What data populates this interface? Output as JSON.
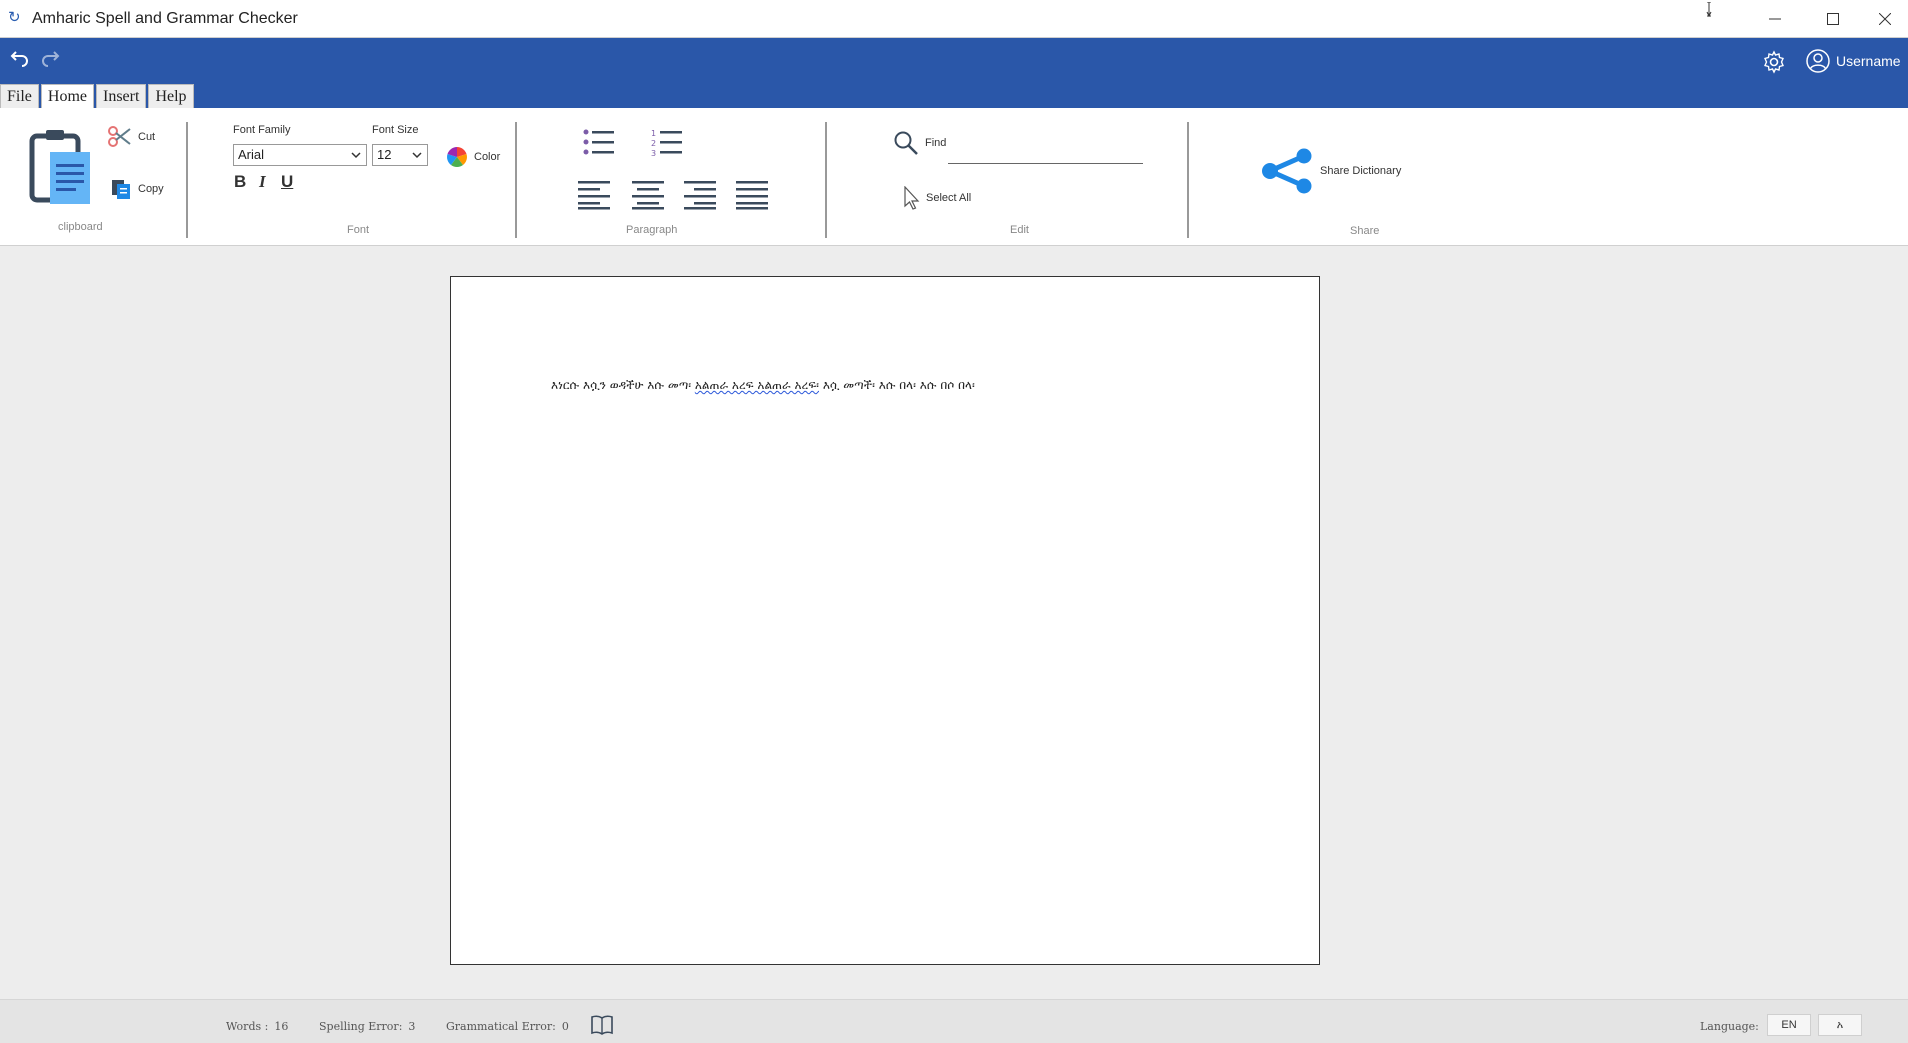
{
  "window": {
    "title": "Amharic Spell and Grammar Checker",
    "app_icon": "amharic-logo-icon"
  },
  "quickbar": {
    "username": "Username"
  },
  "tabs": [
    {
      "label": "File"
    },
    {
      "label": "Home"
    },
    {
      "label": "Insert"
    },
    {
      "label": "Help"
    }
  ],
  "ribbon": {
    "clipboard": {
      "group_label": "clipboard",
      "cut": "Cut",
      "copy": "Copy"
    },
    "font": {
      "group_label": "Font",
      "family_label": "Font Family",
      "family_value": "Arial",
      "size_label": "Font Size",
      "size_value": "12",
      "color": "Color",
      "bold": "B",
      "italic": "I",
      "underline": "U"
    },
    "paragraph": {
      "group_label": "Paragraph"
    },
    "edit": {
      "group_label": "Edit",
      "find": "Find",
      "select_all": "Select All"
    },
    "share": {
      "group_label": "Share",
      "share_dictionary": "Share Dictionary"
    }
  },
  "document": {
    "before": "እነርሱ እሷን ወዳችሁ እሱ መጣ፡ ",
    "error": "አልጠራ አረፍ አልጠራ አረፍ፡",
    "after": " እሷ መጣች፡ እሱ በላ፡ እሱ በሶ በላ፡"
  },
  "status": {
    "words_label": "Words :",
    "words_value": "16",
    "spelling_label": "Spelling Error:",
    "spelling_value": "3",
    "grammar_label": "Grammatical Error:",
    "grammar_value": "0",
    "language_label": "Language:",
    "lang_en": "EN",
    "lang_am": "አ"
  },
  "colors": {
    "accent": "#2a57a9",
    "icon_blue": "#1e88e5"
  }
}
